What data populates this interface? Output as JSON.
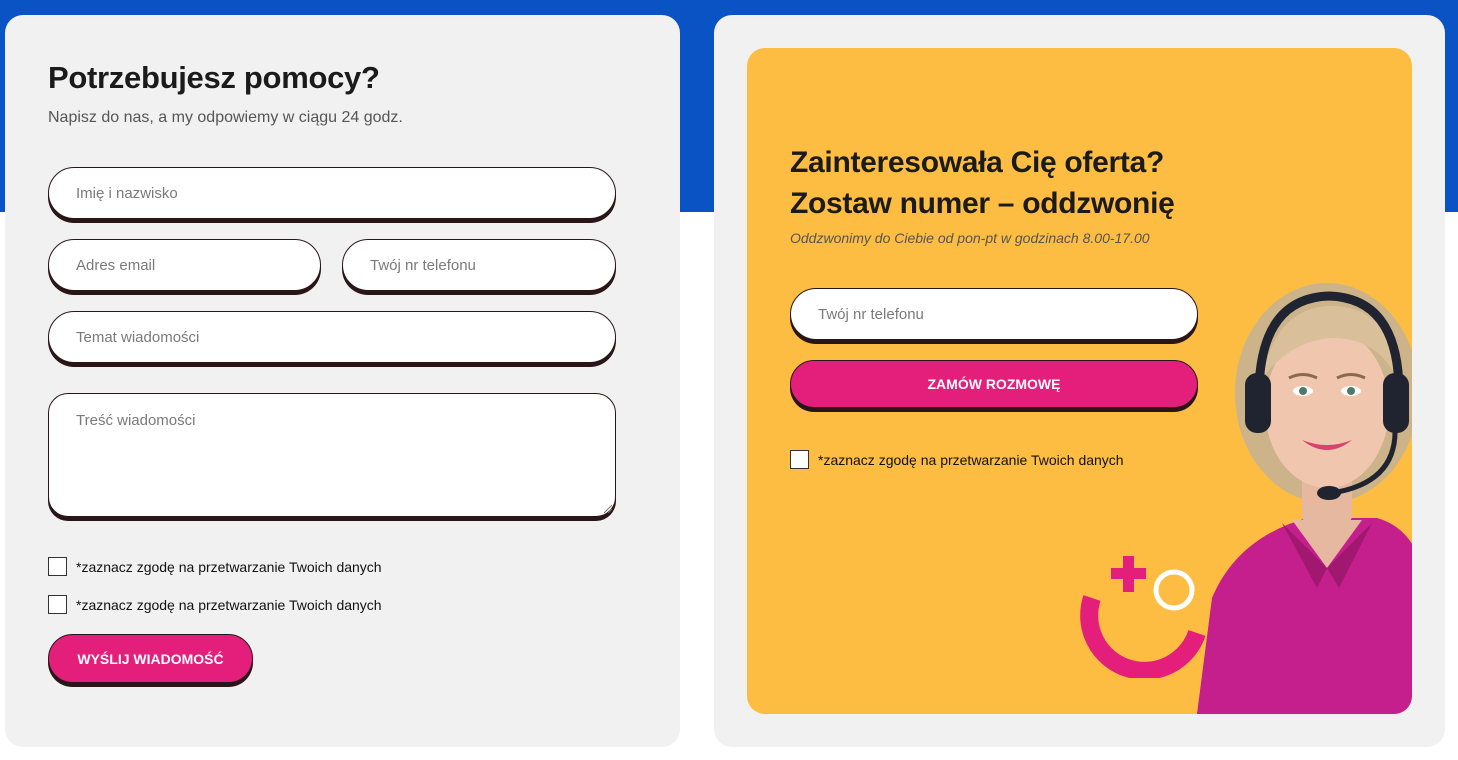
{
  "contact_form": {
    "title": "Potrzebujesz pomocy?",
    "subtitle": "Napisz do nas, a my odpowiemy w ciągu 24 godz.",
    "name_placeholder": "Imię i nazwisko",
    "email_placeholder": "Adres email",
    "phone_placeholder": "Twój nr telefonu",
    "subject_placeholder": "Temat wiadomości",
    "message_placeholder": "Treść wiadomości",
    "consent_1": "*zaznacz zgodę na przetwarzanie Twoich danych",
    "consent_2": "*zaznacz zgodę na przetwarzanie Twoich danych",
    "submit_label": "WYŚLIJ WIADOMOŚĆ"
  },
  "callback": {
    "title_line1": "Zainteresowała Cię oferta?",
    "title_line2": "Zostaw numer – oddzwonię",
    "note": "Oddzwonimy do Ciebie od pon-pt w godzinach 8.00-17.00",
    "phone_placeholder": "Twój nr telefonu",
    "button_label": "ZAMÓW ROZMOWĘ",
    "consent": "*zaznacz zgodę na przetwarzanie Twoich danych"
  },
  "colors": {
    "brand_blue": "#0a53c4",
    "accent_pink": "#e41f7b",
    "promo_yellow": "#fdbd42",
    "card_gray": "#f1f1f1"
  },
  "icons": {
    "decoration": "smile-plus-icon",
    "grip": "resize-grip-icon"
  }
}
